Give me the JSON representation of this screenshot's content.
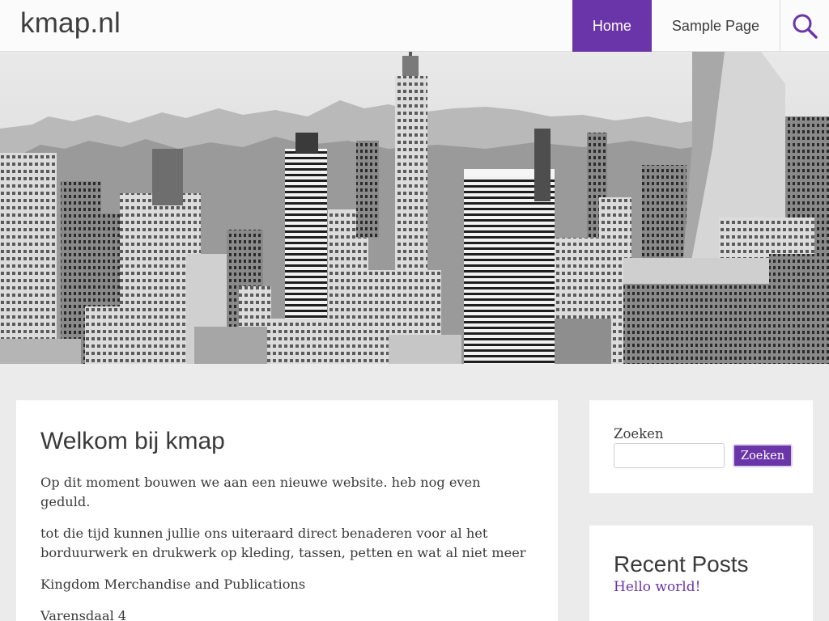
{
  "site": {
    "title": "kmap.nl"
  },
  "nav": {
    "items": [
      {
        "label": "Home",
        "active": true
      },
      {
        "label": "Sample Page",
        "active": false
      }
    ]
  },
  "icons": {
    "search": "search-icon"
  },
  "colors": {
    "accent": "#6a35a8",
    "background": "#ebebeb",
    "card": "#ffffff",
    "text": "#3a3a3a"
  },
  "hero": {
    "description_icon": "city-skyline-image"
  },
  "post": {
    "title": "Welkom bij kmap",
    "paragraphs": [
      "Op dit moment bouwen we aan een nieuwe website. heb nog even geduld.",
      "tot die tijd kunnen jullie ons uiteraard direct benaderen voor al het borduurwerk en drukwerk op kleding, tassen, petten en wat al niet meer",
      "Kingdom Merchandise and Publications",
      "Varensdaal 4"
    ]
  },
  "search_widget": {
    "label": "Zoeken",
    "input_value": "",
    "button_label": "Zoeken"
  },
  "recent_posts": {
    "title": "Recent Posts",
    "items": [
      "Hello world!"
    ]
  }
}
